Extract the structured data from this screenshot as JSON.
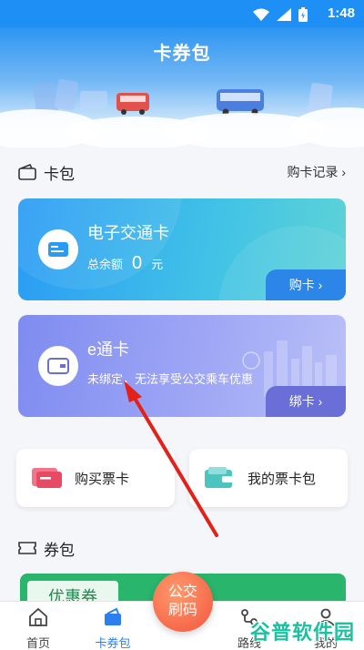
{
  "status_bar": {
    "time": "1:48"
  },
  "header": {
    "title": "卡券包"
  },
  "card_section": {
    "title": "卡包",
    "link": "购卡记录 ›"
  },
  "cards": [
    {
      "title": "电子交通卡",
      "balance_label": "总余额",
      "balance_value": "0",
      "balance_unit": "元",
      "button": "购卡 ›"
    },
    {
      "title": "e通卡",
      "subtitle": "未绑定，无法享受公交乘车优惠",
      "button": "绑卡 ›"
    }
  ],
  "quick_actions": [
    {
      "label": "购买票卡"
    },
    {
      "label": "我的票卡包"
    }
  ],
  "coupon_section": {
    "title": "券包",
    "tag": "优惠券"
  },
  "fab": {
    "line1": "公交",
    "line2": "刷码"
  },
  "tabs": [
    {
      "label": "首页",
      "active": false
    },
    {
      "label": "卡券包",
      "active": true
    },
    {
      "label": "路线",
      "active": false
    },
    {
      "label": "我的",
      "active": false
    }
  ],
  "watermark": "谷普软件园",
  "colors": {
    "primary": "#1e8ff4",
    "card1": "#2a9bf5",
    "card2": "#7f8cf0",
    "fab": "#f2553e",
    "arrow": "#e32119",
    "tab_active": "#2d7ff0"
  }
}
